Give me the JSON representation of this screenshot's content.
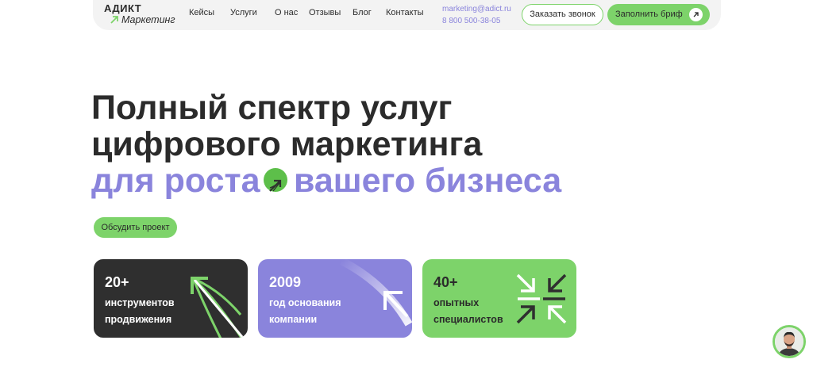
{
  "header": {
    "logo": {
      "top": "АДИКТ",
      "bottom": "Маркетинг"
    },
    "nav": [
      {
        "label": "Кейсы"
      },
      {
        "label": "Услуги"
      },
      {
        "label": "О нас"
      },
      {
        "label": "Отзывы"
      },
      {
        "label": "Блог"
      },
      {
        "label": "Контакты"
      }
    ],
    "contacts": {
      "email": "marketing@adict.ru",
      "phone": "8 800 500-38-05"
    },
    "call_button": "Заказать звонок",
    "brief_button": "Заполнить бриф"
  },
  "hero": {
    "line1": "Полный спектр услуг",
    "line2": "цифрового маркетинга",
    "line3_part1": "для роста",
    "line3_part2": "вашего бизнеса",
    "discuss_button": "Обсудить проект"
  },
  "cards": [
    {
      "number": "20+",
      "line1": "инструментов",
      "line2": "продвижения"
    },
    {
      "number": "2009",
      "line1": "год основания",
      "line2": "компании"
    },
    {
      "number": "40+",
      "line1": "опытных",
      "line2": "специалистов"
    }
  ],
  "colors": {
    "accent_purple": "#8a84dc",
    "accent_green": "#7dd36a",
    "dark": "#2f2f2f"
  },
  "icons": [
    "arrow-up-right-icon",
    "chat-avatar"
  ]
}
